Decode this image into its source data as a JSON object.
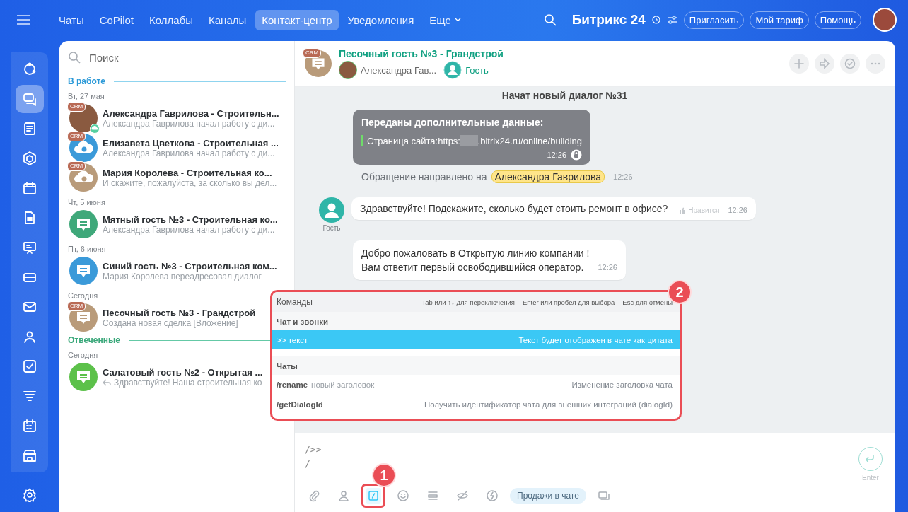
{
  "topbar": {
    "tabs": [
      {
        "label": "Чаты",
        "selected": false
      },
      {
        "label": "CoPilot",
        "selected": false
      },
      {
        "label": "Коллабы",
        "selected": false
      },
      {
        "label": "Каналы",
        "selected": false
      },
      {
        "label": "Контакт-центр",
        "selected": true
      },
      {
        "label": "Уведомления",
        "selected": false
      }
    ],
    "more": "Еще",
    "brand": "Битрикс",
    "brand_number": "24",
    "buttons": [
      "Пригласить",
      "Мой тариф",
      "Помощь"
    ]
  },
  "rail": [
    {
      "kind": "activity",
      "selected": false
    },
    {
      "kind": "chat",
      "selected": true
    },
    {
      "kind": "feed",
      "selected": false
    },
    {
      "kind": "hexagon",
      "selected": false
    },
    {
      "kind": "calendar",
      "selected": false
    },
    {
      "kind": "document",
      "selected": false
    },
    {
      "kind": "presentation",
      "selected": false
    },
    {
      "kind": "drive",
      "selected": false
    },
    {
      "kind": "mail",
      "selected": false
    },
    {
      "kind": "people",
      "selected": false
    },
    {
      "kind": "tasks",
      "selected": false
    },
    {
      "kind": "funnel",
      "selected": false
    },
    {
      "kind": "planner",
      "selected": false
    },
    {
      "kind": "store",
      "selected": false
    }
  ],
  "chat_list": {
    "search": {
      "placeholder": "Поиск"
    },
    "sections": [
      {
        "title": "В работе",
        "kind": "work",
        "groups": [
          {
            "date": "Вт, 27 мая",
            "chats": [
              {
                "title": "Александра Гаврилова - Строительн...",
                "preview": "Александра Гаврилова начал работу с ди...",
                "kind": "photo",
                "badge": "CRM",
                "replied": false
              },
              {
                "title": "Елизавета Цветкова - Строительная ...",
                "preview": "Александра Гаврилова начал работу с ди...",
                "kind": "cloud",
                "color": "#3b9ad9",
                "badge": "CRM",
                "replied": false
              },
              {
                "title": "Мария Королева - Строительная ко...",
                "preview": "И скажите, пожалуйста, за сколько вы дел...",
                "kind": "cloud",
                "color": "#b99b7a",
                "badge": "CRM",
                "replied": false
              }
            ]
          },
          {
            "date": "Чт, 5 июня",
            "chats": [
              {
                "title": "Мятный гость №3 - Строительная ко...",
                "preview": "Александра Гаврилова начал работу с ди...",
                "kind": "bubble",
                "color": "#3fa87a",
                "replied": false
              }
            ]
          },
          {
            "date": "Пт, 6 июня",
            "chats": [
              {
                "title": "Синий гость №3 - Строительная ком...",
                "preview": "Мария Королева переадресовал диалог",
                "kind": "bubble",
                "color": "#3b9ad9",
                "replied": false
              }
            ]
          },
          {
            "date": "Сегодня",
            "chats": [
              {
                "title": "Песочный гость №3 - Грандстрой",
                "preview": "Создана новая сделка [Вложение]",
                "kind": "bubble",
                "color": "#b99b7a",
                "badge": "CRM",
                "replied": false
              }
            ]
          }
        ]
      },
      {
        "title": "Отвеченные",
        "kind": "answered",
        "groups": [
          {
            "date": "Сегодня",
            "chats": [
              {
                "title": "Салатовый гость №2 - Открытая ...",
                "preview": "Здравствуйте! Наша строительная ко",
                "kind": "bubble",
                "color": "#5cc14a",
                "replied": true
              }
            ]
          }
        ]
      }
    ]
  },
  "dialog": {
    "title": "Песочный гость №3 - Грандстрой",
    "badge": "CRM",
    "members": [
      {
        "name": "Александра Гав...",
        "kind": "operator"
      },
      {
        "name": "Гость",
        "kind": "guest"
      }
    ],
    "actions": [
      {
        "kind": "plus"
      },
      {
        "kind": "forward"
      },
      {
        "kind": "check"
      },
      {
        "kind": "more"
      }
    ],
    "messages": [
      {
        "kind": "system",
        "text": "Начат новый диалог №31"
      },
      {
        "kind": "data",
        "heading": "Переданы дополнительные данные:",
        "label": "Страница сайта:",
        "url_start": "https:",
        "url_end": ".bitrix24.ru/online/building",
        "time": "12:26"
      },
      {
        "kind": "routing",
        "text": "Обращение направлено на",
        "name": "Александра Гаврилова",
        "time": "12:26"
      },
      {
        "kind": "guest",
        "author": "Гость",
        "text": "Здравствуйте! Подскажите, сколько будет стоить ремонт в офисе?",
        "like": "Нравится",
        "time": "12:26"
      },
      {
        "kind": "bot",
        "lines": [
          "Добро пожаловать в Открытую линию компании !",
          "Вам ответит первый освободившийся оператор."
        ],
        "time": "12:26"
      }
    ],
    "input": {
      "lines": [
        "/>>",
        "/"
      ],
      "send_hint": "Enter"
    },
    "toolbar": [
      {
        "kind": "clip",
        "selected": false
      },
      {
        "kind": "person",
        "selected": false
      },
      {
        "kind": "slash",
        "selected": true,
        "marker": "1"
      },
      {
        "kind": "smile",
        "selected": false
      },
      {
        "kind": "layers",
        "selected": false
      },
      {
        "kind": "eye-off",
        "selected": false
      },
      {
        "kind": "bolt",
        "selected": false
      },
      {
        "kind": "chip",
        "label": "Продажи в чате"
      },
      {
        "kind": "windows",
        "selected": false
      }
    ]
  },
  "commands": {
    "title": "Команды",
    "marker": "2",
    "hints": [
      "Tab или ↑↓ для переключения",
      "Enter или пробел для выбора",
      "Esc для отмены"
    ],
    "sections": [
      {
        "title": "Чат и звонки",
        "items": [
          {
            "command": ">>  текст",
            "description": "Текст будет отображен в чате как цитата",
            "selected": true
          }
        ]
      },
      {
        "title": "Чаты",
        "items": [
          {
            "command": "/rename",
            "argument": "новый заголовок",
            "description": "Изменение заголовка чата",
            "selected": false
          },
          {
            "command": "/getDialogId",
            "description": "Получить идентификатор чата для внешних интеграций (dialogId)",
            "selected": false
          }
        ]
      }
    ]
  }
}
